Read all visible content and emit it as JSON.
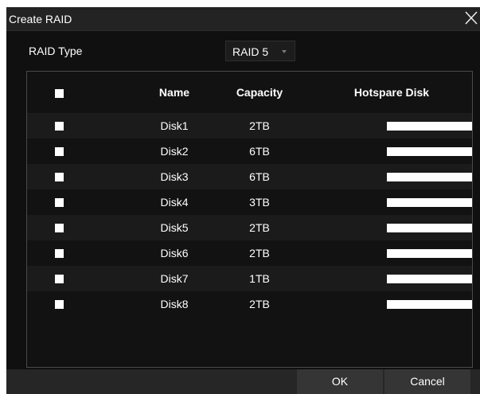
{
  "dialog": {
    "title": "Create RAID",
    "close_icon": "close-icon"
  },
  "raid_type": {
    "label": "RAID Type",
    "selected": "RAID 5",
    "dropdown_icon": "caret-down-icon"
  },
  "table": {
    "headers": {
      "name": "Name",
      "capacity": "Capacity",
      "hotspare": "Hotspare Disk"
    },
    "rows": [
      {
        "name": "Disk1",
        "capacity": "2TB"
      },
      {
        "name": "Disk2",
        "capacity": "6TB"
      },
      {
        "name": "Disk3",
        "capacity": "6TB"
      },
      {
        "name": "Disk4",
        "capacity": "3TB"
      },
      {
        "name": "Disk5",
        "capacity": "2TB"
      },
      {
        "name": "Disk6",
        "capacity": "2TB"
      },
      {
        "name": "Disk7",
        "capacity": "1TB"
      },
      {
        "name": "Disk8",
        "capacity": "2TB"
      }
    ]
  },
  "footer": {
    "ok_label": "OK",
    "cancel_label": "Cancel"
  },
  "colors": {
    "background": "#101010",
    "title_bar": "#232323",
    "row_alt": "#1b1b1b",
    "button": "#353535",
    "text": "#ffffff"
  }
}
